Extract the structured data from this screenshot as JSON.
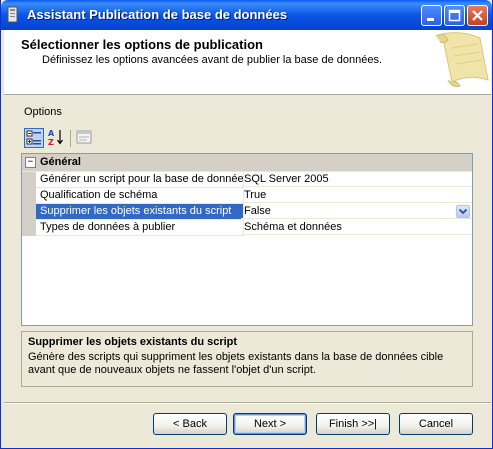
{
  "window": {
    "title": "Assistant Publication de base de données"
  },
  "header": {
    "title": "Sélectionner les options de publication",
    "subtitle": "Définissez les options avancées avant de publier la base de données."
  },
  "options_label": "Options",
  "toolbar": {
    "categorized_icon": "categorized-icon",
    "alphabetical_icon": "alphabetical-icon",
    "property_pages_icon": "property-pages-icon"
  },
  "grid": {
    "category": "Général",
    "category_toggle": "−",
    "rows": [
      {
        "name": "Générer un script pour la base de donnée:",
        "value": "SQL Server 2005"
      },
      {
        "name": "Qualification de schéma",
        "value": "True"
      },
      {
        "name": "Supprimer les objets existants du script",
        "value": "False"
      },
      {
        "name": "Types de données à publier",
        "value": "Schéma et données"
      }
    ],
    "selected_index": 2
  },
  "description": {
    "title": "Supprimer les objets existants du script",
    "text": "Génère des scripts qui suppriment les objets existants dans la base de données cible avant que de nouveaux objets ne fassent l'objet d'un script."
  },
  "buttons": {
    "back": "< Back",
    "next": "Next >",
    "finish": "Finish >>|",
    "cancel": "Cancel"
  },
  "colors": {
    "titlebar": "#0b56e8",
    "selection": "#316ac5",
    "window_bg": "#ece9d8"
  }
}
